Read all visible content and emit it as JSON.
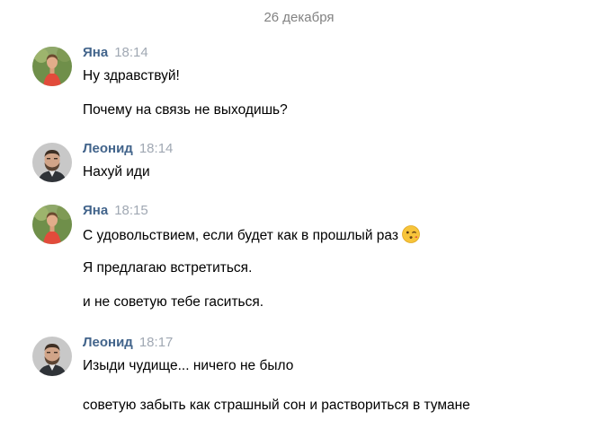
{
  "date_divider": "26 декабря",
  "messages": [
    {
      "author": "Яна",
      "time": "18:14",
      "avatar_icon": "female-avatar",
      "lines": [
        "Ну здравствуй!",
        "Почему на связь не выходишь?"
      ]
    },
    {
      "author": "Леонид",
      "time": "18:14",
      "avatar_icon": "male-avatar",
      "lines": [
        "Нахуй иди"
      ]
    },
    {
      "author": "Яна",
      "time": "18:15",
      "avatar_icon": "female-avatar",
      "lines": [
        "С удовольствием, если будет как в прошлый раз",
        "Я предлагаю встретиться.",
        "и не советую тебе гаситься."
      ],
      "emoji": "winking-kiss-emoji"
    },
    {
      "author": "Леонид",
      "time": "18:17",
      "avatar_icon": "male-avatar",
      "lines": [
        "Изыди чудище... ничего не было",
        "советую забыть как страшный сон и раствориться в тумане"
      ]
    }
  ],
  "colors": {
    "author_name": "#42648b",
    "timestamp": "#a0a8b3",
    "date_divider": "#828282",
    "message_text": "#000000",
    "background": "#ffffff"
  }
}
